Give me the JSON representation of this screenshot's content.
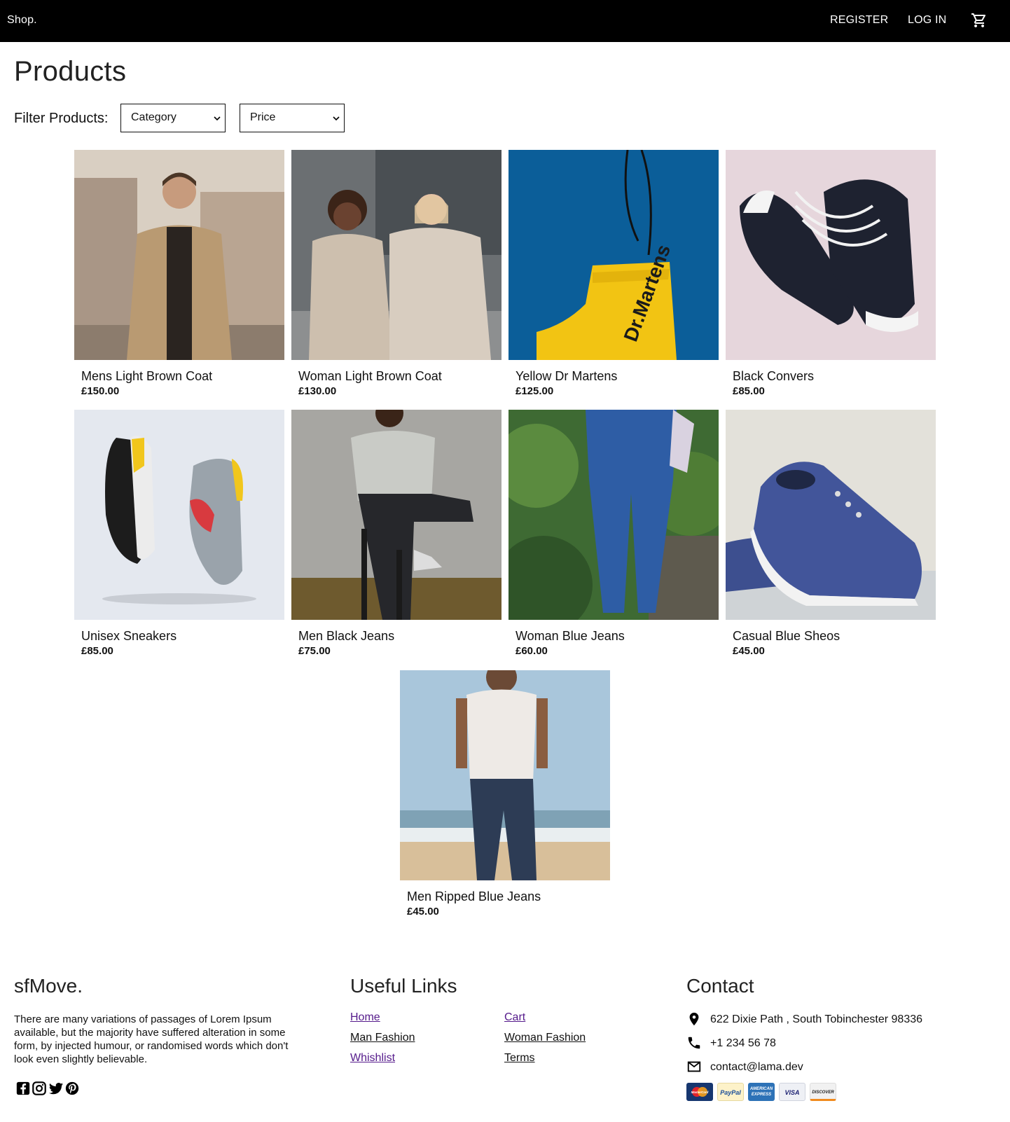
{
  "navbar": {
    "brand": "Shop.",
    "register": "REGISTER",
    "login": "LOG IN",
    "cart_icon": "cart-icon"
  },
  "page": {
    "title": "Products",
    "filter_label": "Filter Products:",
    "category_select": "Category",
    "price_select": "Price"
  },
  "products": [
    {
      "name": "Mens Light Brown Coat",
      "price": "£150.00"
    },
    {
      "name": "Woman Light Brown Coat",
      "price": "£130.00"
    },
    {
      "name": "Yellow Dr Martens",
      "price": "£125.00"
    },
    {
      "name": "Black Convers",
      "price": "£85.00"
    },
    {
      "name": "Unisex Sneakers",
      "price": "£85.00"
    },
    {
      "name": "Men Black Jeans",
      "price": "£75.00"
    },
    {
      "name": "Woman Blue Jeans",
      "price": "£60.00"
    },
    {
      "name": "Casual Blue Sheos",
      "price": "£45.00"
    },
    {
      "name": "Men Ripped Blue Jeans",
      "price": "£45.00"
    }
  ],
  "footer": {
    "brand": "sfMove.",
    "description": "There are many variations of passages of Lorem Ipsum available, but the majority have suffered alteration in some form, by injected humour, or randomised words which don't look even slightly believable.",
    "social_icons": [
      "facebook-icon",
      "instagram-icon",
      "twitter-icon",
      "pinterest-icon"
    ],
    "links_title": "Useful Links",
    "links": {
      "home": "Home",
      "cart": "Cart",
      "man_fashion": "Man Fashion",
      "woman_fashion": "Woman Fashion",
      "whishlist": "Whishlist",
      "terms": "Terms"
    },
    "contact_title": "Contact",
    "address": "622 Dixie Path , South Tobinchester 98336",
    "phone": "+1 234 56 78",
    "email": "contact@lama.dev",
    "payments": {
      "mastercard": "MasterCard",
      "paypal": "PayPal",
      "amex": "AMERICAN EXPRESS",
      "visa": "VISA",
      "discover": "DISCOVER"
    }
  },
  "colors": {
    "navbar_bg": "#000000",
    "visited_link": "#551a8b"
  }
}
